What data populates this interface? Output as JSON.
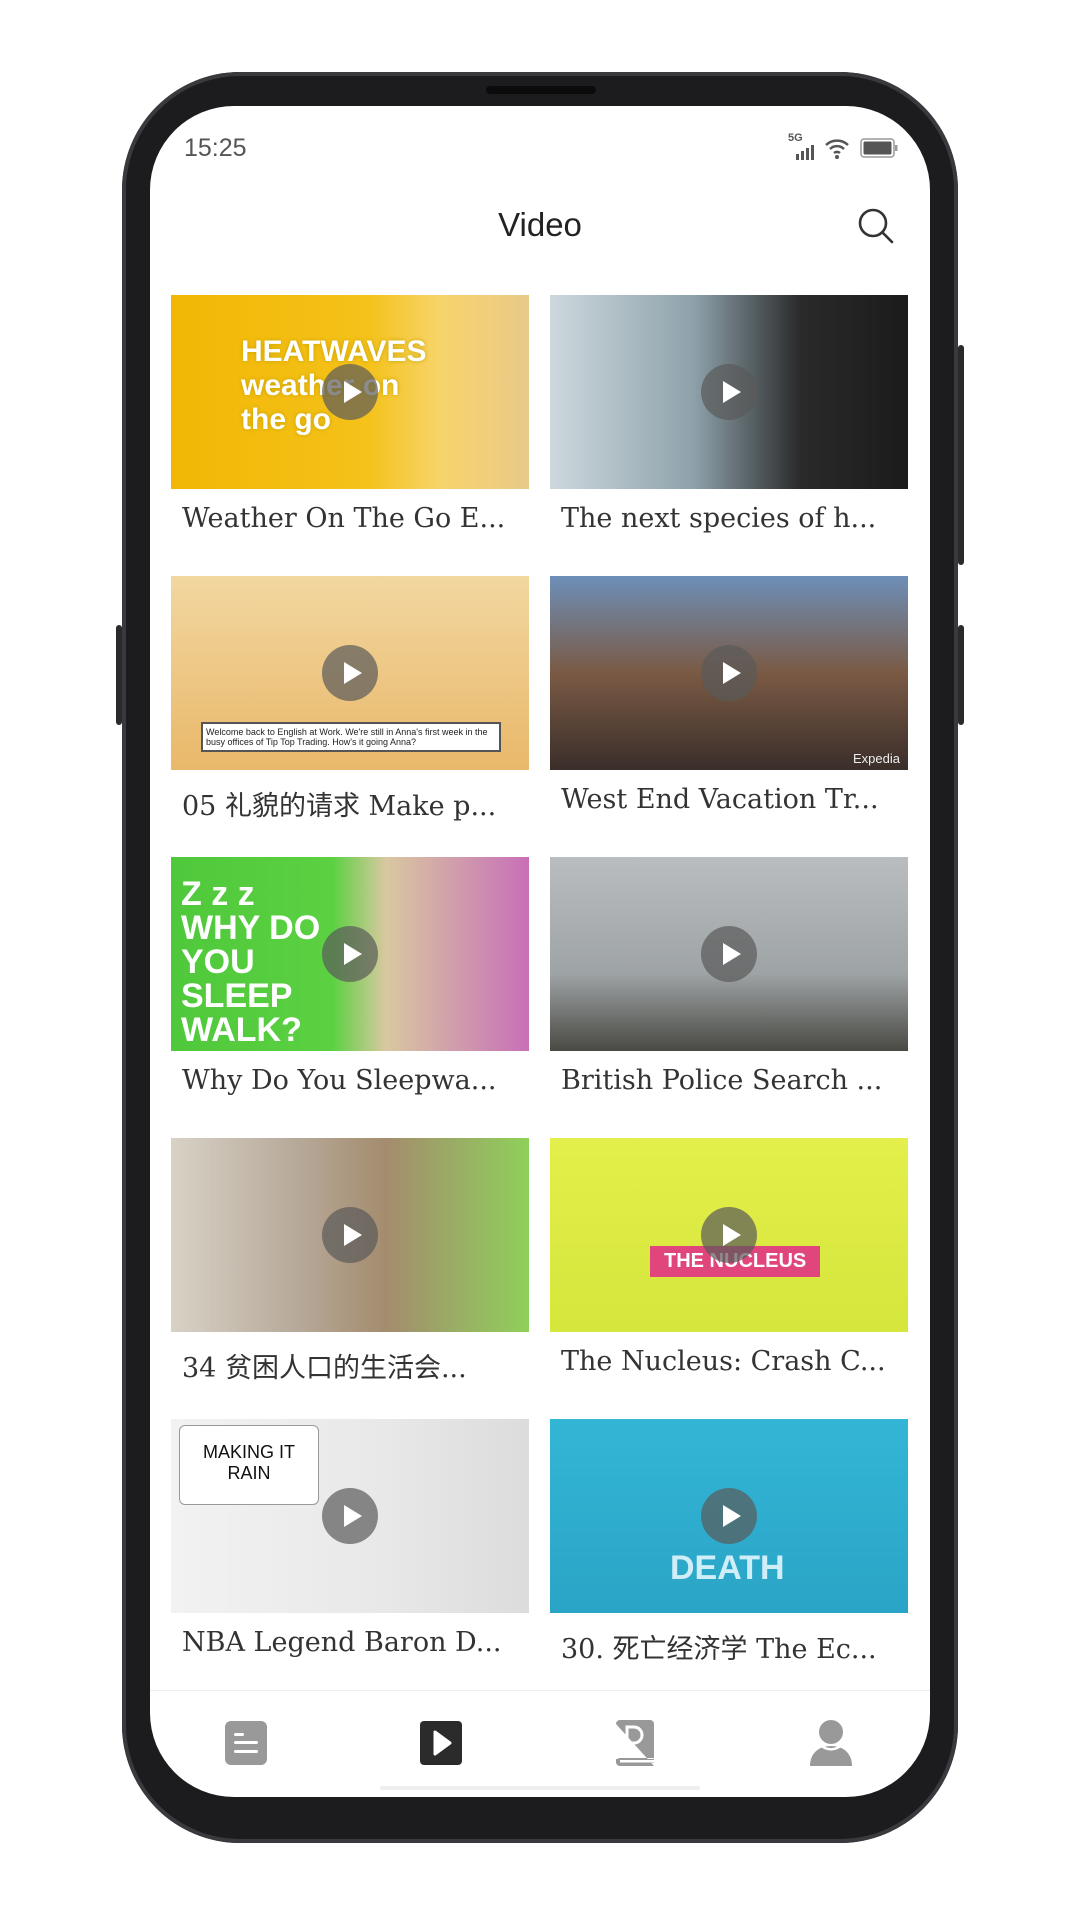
{
  "status": {
    "time": "15:25",
    "network": "5G"
  },
  "header": {
    "title": "Video",
    "search_icon": "search-icon"
  },
  "videos": [
    {
      "title": "Weather On The Go E...",
      "bg": "linear-gradient(90deg,#f2b705 0%,#f4c21a 55%,#f7d46a 75%,#e9c98a 100%)",
      "overlay": "HEATWAVES weather on the go"
    },
    {
      "title": "The next species of h...",
      "bg": "linear-gradient(90deg,#cdd8dd 0%,#8ea2ab 40%,#2a2a2a 70%,#1b1b1b 100%)",
      "overlay": ""
    },
    {
      "title": "05 礼貌的请求 Make p...",
      "bg": "linear-gradient(180deg,#f2d7a0 0%,#e9b86a 100%)",
      "overlay": "Welcome back to English at Work. We're still in Anna's first week in the busy offices of Tip Top Trading. How's it going Anna?"
    },
    {
      "title": "West End Vacation Tr...",
      "bg": "linear-gradient(180deg,#6d8fb8 0%,#7a5a44 50%,#3a2e2a 100%)",
      "overlay": "Expedia"
    },
    {
      "title": "Why Do You Sleepwa...",
      "bg": "linear-gradient(90deg,#4fc83b 0%,#5bd142 45%,#d9c8a0 60%,#c86fb8 100%)",
      "overlay": "Z z z WHY DO YOU SLEEP WALK?"
    },
    {
      "title": "British Police Search ...",
      "bg": "linear-gradient(180deg,#b9bdbf 0%,#9ea3a5 60%,#4a4a44 100%)",
      "overlay": ""
    },
    {
      "title": "34 贫困人口的生活会...",
      "bg": "linear-gradient(90deg,#d8d2c6 0%,#b7a99a 35%,#a48c6e 60%,#8fd05a 100%)",
      "overlay": ""
    },
    {
      "title": "The Nucleus: Crash C...",
      "bg": "linear-gradient(180deg,#e3ef4a 0%,#d5e63c 100%)",
      "overlay": "THE NUCLEUS"
    },
    {
      "title": "NBA Legend Baron D...",
      "bg": "linear-gradient(90deg,#f2f2f2 0%,#e8e8e8 60%,#dcdcdc 100%)",
      "overlay": "MAKING IT RAIN"
    },
    {
      "title": "30. 死亡经济学 The Ec...",
      "bg": "linear-gradient(180deg,#33b6d6 0%,#2aa4c6 100%)",
      "overlay": "DEATH"
    }
  ],
  "bottom_nav": [
    {
      "name": "articles",
      "icon": "document-icon",
      "active": false
    },
    {
      "name": "video",
      "icon": "play-icon",
      "active": true
    },
    {
      "name": "dictionary",
      "icon": "dictionary-icon",
      "active": false
    },
    {
      "name": "profile",
      "icon": "user-icon",
      "active": false
    }
  ],
  "colors": {
    "active": "#2b2b2b",
    "inactive": "#999999",
    "text": "#333333"
  }
}
